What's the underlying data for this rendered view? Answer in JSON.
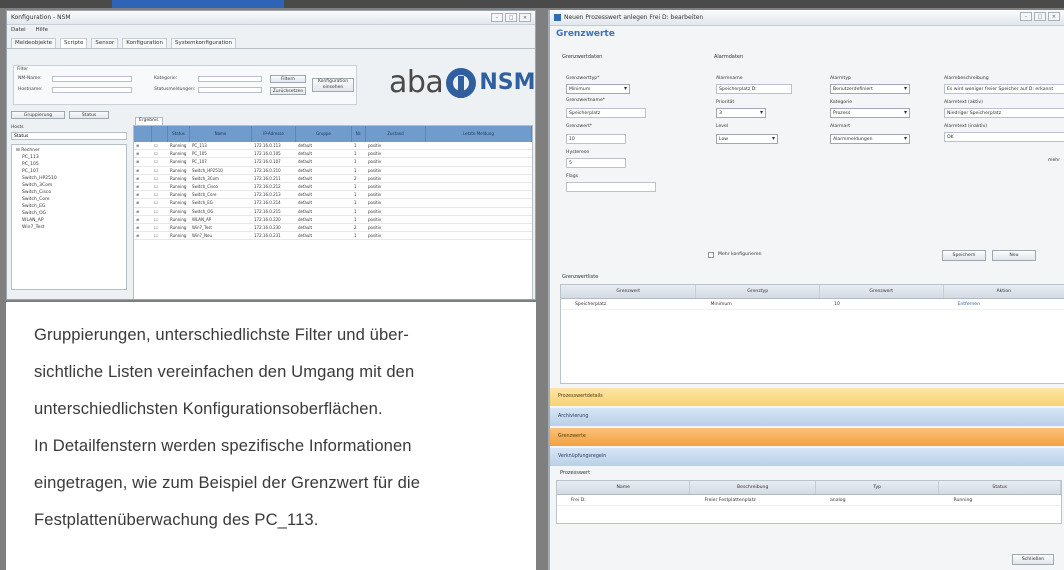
{
  "left_window": {
    "title": "Konfiguration - NSM",
    "menu": [
      "Datei",
      "Hilfe"
    ],
    "tabs": [
      "Meldeobjekte",
      "Scripte",
      "Sensor",
      "Konfiguration",
      "Systemkonfiguration"
    ],
    "filter_title": "Filter",
    "filter_labels": [
      "NM-Name:",
      "Hostname:",
      "Kategorie:",
      "Statusmeldungen:"
    ],
    "buttons": [
      "Filtern",
      "Zurücksetzen",
      "Konfiguration einsehen"
    ],
    "group_select": "Gruppierung",
    "group_mode": "Status",
    "tree_label": "Hosts",
    "tree_root": "Rechner",
    "tree_items": [
      "PC_113",
      "PC_105",
      "PC_107",
      "Switch_HP2510",
      "Switch_3Com",
      "Switch_Cisco",
      "Switch_Core",
      "Switch_EG",
      "Switch_OG",
      "WLAN_AP",
      "Win7_Test"
    ],
    "grid_tab": "Ergebnis",
    "grid_columns": [
      "",
      "Status",
      "Name",
      "IP-Adresse",
      "Gruppe",
      "Nr.",
      "Zustand",
      "Letzte Meldung"
    ],
    "grid_rows": [
      [
        "Running",
        "PC_113",
        "172.16.0.113",
        "default",
        "1",
        "positiv"
      ],
      [
        "Running",
        "PC_105",
        "172.16.0.105",
        "default",
        "1",
        "positiv"
      ],
      [
        "Running",
        "PC_107",
        "172.16.0.107",
        "default",
        "1",
        "positiv"
      ],
      [
        "Running",
        "Switch_HP2510",
        "172.16.0.210",
        "default",
        "1",
        "positiv"
      ],
      [
        "Running",
        "Switch_3Com",
        "172.16.0.211",
        "default",
        "2",
        "positiv"
      ],
      [
        "Running",
        "Switch_Cisco",
        "172.16.0.212",
        "default",
        "1",
        "positiv"
      ],
      [
        "Running",
        "Switch_Core",
        "172.16.0.213",
        "default",
        "1",
        "positiv"
      ],
      [
        "Running",
        "Switch_EG",
        "172.16.0.214",
        "default",
        "1",
        "positiv"
      ],
      [
        "Running",
        "Switch_OG",
        "172.16.0.215",
        "default",
        "1",
        "positiv"
      ],
      [
        "Running",
        "WLAN_AP",
        "172.16.0.220",
        "default",
        "1",
        "positiv"
      ],
      [
        "Running",
        "Win7_Test",
        "172.16.0.230",
        "default",
        "2",
        "positiv"
      ],
      [
        "Running",
        "Win7_Neu",
        "172.16.0.231",
        "default",
        "1",
        "positiv"
      ]
    ]
  },
  "logo": {
    "left": "aba",
    "right": "NSM",
    "mark": "®"
  },
  "caption": {
    "lines": [
      "Gruppierungen, unterschiedlichste Filter und über-",
      "sichtliche Listen vereinfachen den Umgang mit den",
      "unterschiedlichsten Konfigurationsoberflächen.",
      "In Detailfenstern werden spezifische Informationen",
      "eingetragen, wie zum Beispiel der Grenzwert für die",
      "Festplattenüberwachung des PC_113."
    ]
  },
  "right_window": {
    "title": "Neuen Prozesswert anlegen Frei D: bearbeiten",
    "heading": "Grenzwerte",
    "section_general": "Grenzwertdaten",
    "section_alarm": "Alarmdaten",
    "fields": {
      "threshold_type_label": "Grenzwerttyp*",
      "threshold_type": "Minimum",
      "threshold_name_label": "Grenzwertname*",
      "threshold_name": "Speicherplatz",
      "threshold_label": "Grenzwert*",
      "threshold": "10",
      "hysteresis_label": "Hysterese",
      "hysteresis": "5",
      "flags_label": "Flags",
      "alarm_name_label": "Alarmname",
      "alarm_name": "Speicherplatz D:",
      "priority_label": "Priorität",
      "priority": "3",
      "level_label": "Level",
      "level": "Low",
      "alarm_type_label": "Alarmtyp",
      "alarm_type": "Benutzerdefiniert",
      "category_label": "Kategorie",
      "category": "Prozess",
      "alarm_mode_label": "Alarmart",
      "alarm_mode": "Alarmmeldungen",
      "desc_label": "Alarmbeschreibung",
      "desc": "Es wird weniger freier Speicher auf D: erkannt",
      "text_active_label": "Alarmtext (aktiv)",
      "text_active": "Niedriger Speicherplatz",
      "text_inactive_label": "Alarmtext (inaktiv)",
      "text_inactive": "OK",
      "extra_label": "mehr"
    },
    "checkbox_label": "Mehr konfigurieren",
    "btn_save": "Speichern",
    "btn_cancel": "Neu",
    "limits_title": "Grenzwertliste",
    "limits_columns": [
      "Grenzwert",
      "Grenztyp",
      "Grenzwert",
      "Aktion"
    ],
    "limits_row": [
      "Speicherplatz",
      "Minimum",
      "10",
      "Entfernen"
    ],
    "bands": [
      "Prozesswertdetails",
      "Archivierung",
      "Grenzwerte",
      "Verknüpfungsregeln"
    ],
    "process_title": "Prozesswert",
    "process_columns": [
      "Name",
      "Beschreibung",
      "Typ",
      "Status"
    ],
    "process_row": [
      "Frei D:",
      "Freier Festplattenplatz",
      "analog",
      "Running"
    ],
    "btn_close": "Schließen"
  }
}
